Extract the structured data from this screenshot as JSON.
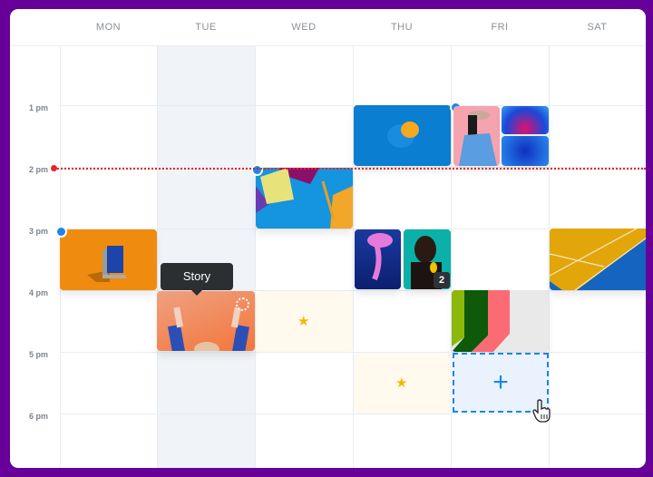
{
  "days": [
    "MON",
    "TUE",
    "WED",
    "THU",
    "FRI",
    "SAT"
  ],
  "today": "TUE",
  "time_labels": [
    "1 pm",
    "2 pm",
    "3 pm",
    "4 pm",
    "5 pm",
    "6 pm"
  ],
  "current_time": "2 pm",
  "tooltip": {
    "label": "Story"
  },
  "events": [
    {
      "day": "MON",
      "start": "3 pm",
      "type": "post",
      "image": "orange-book"
    },
    {
      "day": "TUE",
      "start": "4 pm",
      "type": "story",
      "image": "orange-hands"
    },
    {
      "day": "WED",
      "start": "2 pm",
      "type": "post",
      "image": "blue-paper-pencil"
    },
    {
      "day": "WED",
      "start": "4 pm",
      "type": "placeholder",
      "icon": "star-icon"
    },
    {
      "day": "THU",
      "start": "1 pm",
      "type": "post",
      "image": "blue-orange-fruit"
    },
    {
      "day": "THU",
      "start": "3 pm",
      "type": "carousel",
      "images": [
        "jellyfish",
        "woman-teal"
      ],
      "badge": "2"
    },
    {
      "day": "THU",
      "start": "5 pm",
      "type": "placeholder",
      "icon": "star-icon"
    },
    {
      "day": "FRI",
      "start": "1 pm",
      "type": "multi",
      "images": [
        "woman-cap",
        "blue-abstract-1",
        "blue-abstract-2"
      ]
    },
    {
      "day": "FRI",
      "start": "4 pm",
      "type": "post",
      "image": "green-pink-stripes"
    },
    {
      "day": "FRI",
      "start": "5 pm",
      "type": "new-slot",
      "icon": "plus-icon"
    },
    {
      "day": "SAT",
      "start": "3 pm",
      "type": "post",
      "image": "tennis-court"
    }
  ],
  "colors": {
    "background": "#660099",
    "accent": "#1a86e8",
    "now_line": "#e8222a",
    "today_column": "#f0f3f8"
  }
}
